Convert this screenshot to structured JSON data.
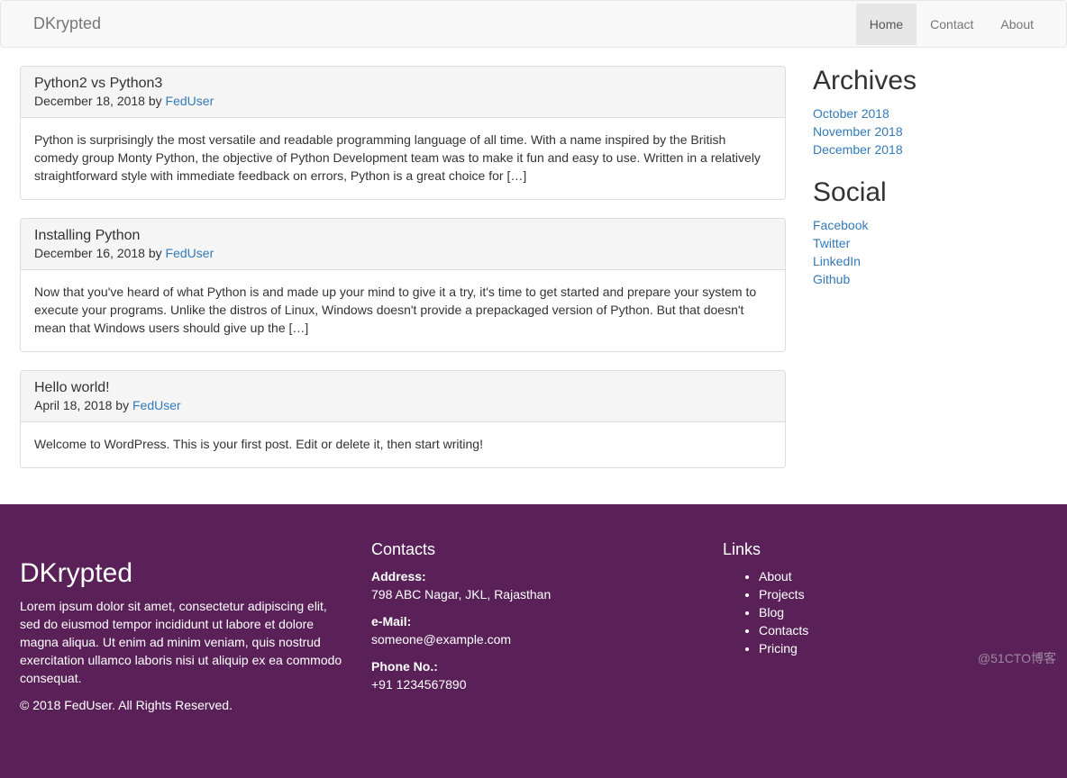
{
  "site": {
    "brand": "DKrypted"
  },
  "nav": {
    "items": [
      {
        "label": "Home",
        "active": true
      },
      {
        "label": "Contact",
        "active": false
      },
      {
        "label": "About",
        "active": false
      }
    ]
  },
  "posts": [
    {
      "title": "Python2 vs Python3",
      "date": "December 18, 2018",
      "by": "by",
      "author": "FedUser",
      "excerpt": "Python is surprisingly the most versatile and readable programming language of all time. With a name inspired by the British comedy group Monty Python, the objective of Python Development team was to make it fun and easy to use. Written in a relatively straightforward style with immediate feedback on errors, Python is a great choice for […]"
    },
    {
      "title": "Installing Python",
      "date": "December 16, 2018",
      "by": "by",
      "author": "FedUser",
      "excerpt": "Now that you've heard of what Python is and made up your mind to give it a try, it's time to get started and prepare your system to execute your programs. Unlike the distros of Linux, Windows doesn't provide a prepackaged version of Python. But that doesn't mean that Windows users should give up the […]"
    },
    {
      "title": "Hello world!",
      "date": "April 18, 2018",
      "by": "by",
      "author": "FedUser",
      "excerpt": "Welcome to WordPress. This is your first post. Edit or delete it, then start writing!"
    }
  ],
  "sidebar": {
    "archives_title": "Archives",
    "archives": [
      "October 2018",
      "November 2018",
      "December 2018"
    ],
    "social_title": "Social",
    "social": [
      "Facebook",
      "Twitter",
      "LinkedIn",
      "Github"
    ]
  },
  "footer": {
    "brand": "DKrypted",
    "desc": "Lorem ipsum dolor sit amet, consectetur adipiscing elit, sed do eiusmod tempor incididunt ut labore et dolore magna aliqua. Ut enim ad minim veniam, quis nostrud exercitation ullamco laboris nisi ut aliquip ex ea commodo consequat.",
    "copyright": "© 2018 FedUser. All Rights Reserved.",
    "contacts_title": "Contacts",
    "address_label": "Address:",
    "address": "798 ABC Nagar, JKL, Rajasthan",
    "email_label": "e-Mail:",
    "email": "someone@example.com",
    "phone_label": "Phone No.:",
    "phone": "+91 1234567890",
    "links_title": "Links",
    "links": [
      "About",
      "Projects",
      "Blog",
      "Contacts",
      "Pricing"
    ]
  },
  "watermark": "@51CTO博客"
}
